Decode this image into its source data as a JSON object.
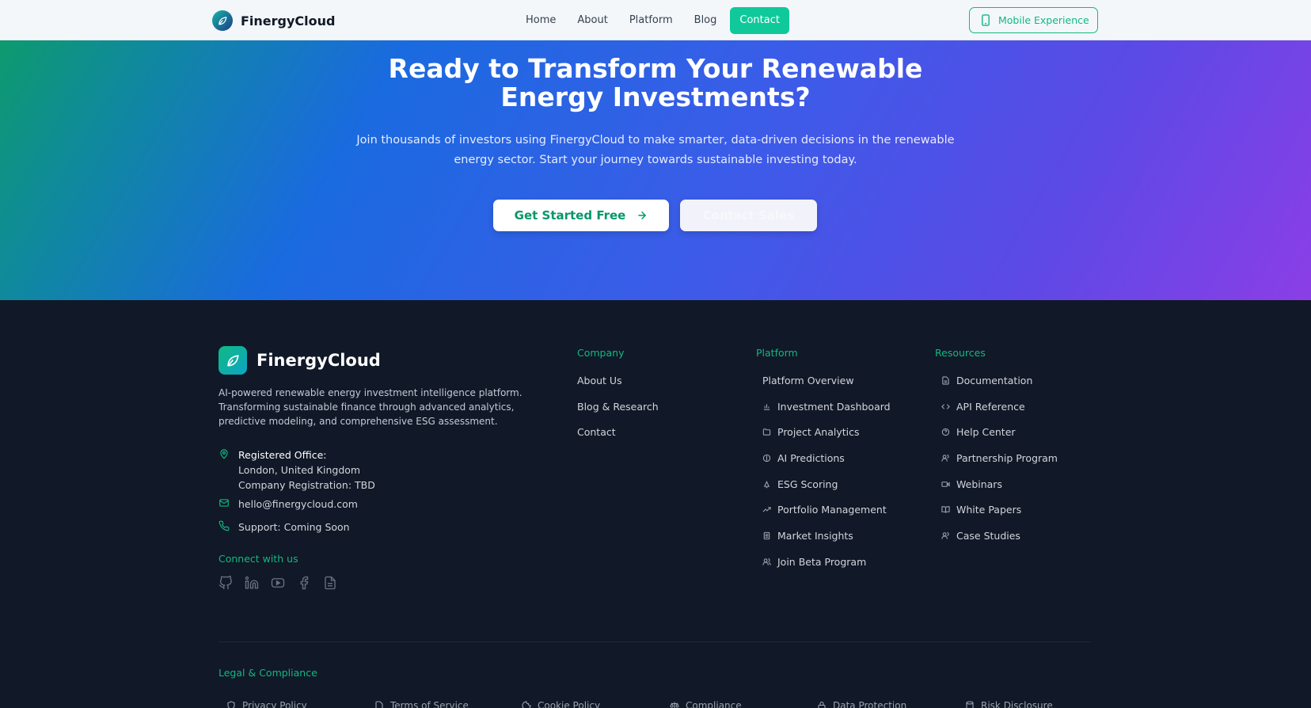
{
  "nav": {
    "brand": "FinergyCloud",
    "links": [
      {
        "label": "Home"
      },
      {
        "label": "About"
      },
      {
        "label": "Platform"
      },
      {
        "label": "Blog"
      },
      {
        "label": "Contact"
      }
    ],
    "mobile_button": "Mobile Experience"
  },
  "hero": {
    "title": "Ready to Transform Your Renewable Energy Investments?",
    "subtitle": "Join thousands of investors using FinergyCloud to make smarter, data-driven decisions in the renewable energy sector. Start your journey towards sustainable investing today.",
    "primary_button": "Get Started Free",
    "secondary_button": "Contact Sales"
  },
  "footer": {
    "brand": "FinergyCloud",
    "description": "AI-powered renewable energy investment intelligence platform. Transforming sustainable finance through advanced analytics, predictive modeling, and comprehensive ESG assessment.",
    "office": {
      "label": "Registered Office:",
      "line1": "London, United Kingdom",
      "line2": "Company Registration: TBD"
    },
    "email": "hello@finergycloud.com",
    "support": "Support: Coming Soon",
    "connect_title": "Connect with us",
    "socials": [
      "github-icon",
      "linkedin-icon",
      "youtube-icon",
      "facebook-icon",
      "document-icon"
    ],
    "company": {
      "title": "Company",
      "items": [
        {
          "label": "About Us"
        },
        {
          "label": "Blog & Research"
        },
        {
          "label": "Contact"
        }
      ]
    },
    "platform": {
      "title": "Platform",
      "items": [
        {
          "label": "Platform Overview",
          "icon": ""
        },
        {
          "label": "Investment Dashboard",
          "icon": "bar-chart-icon"
        },
        {
          "label": "Project Analytics",
          "icon": "folder-icon"
        },
        {
          "label": "AI Predictions",
          "icon": "brain-icon"
        },
        {
          "label": "ESG Scoring",
          "icon": "leaf-icon"
        },
        {
          "label": "Portfolio Management",
          "icon": "trending-up-icon"
        },
        {
          "label": "Market Insights",
          "icon": "newspaper-icon"
        },
        {
          "label": "Join Beta Program",
          "icon": "users-icon"
        }
      ]
    },
    "resources": {
      "title": "Resources",
      "items": [
        {
          "label": "Documentation",
          "icon": "file-icon"
        },
        {
          "label": "API Reference",
          "icon": "code-icon"
        },
        {
          "label": "Help Center",
          "icon": "help-icon"
        },
        {
          "label": "Partnership Program",
          "icon": "users-icon"
        },
        {
          "label": "Webinars",
          "icon": "video-icon"
        },
        {
          "label": "White Papers",
          "icon": "book-icon"
        },
        {
          "label": "Case Studies",
          "icon": "users-icon"
        }
      ]
    },
    "legal": {
      "title": "Legal & Compliance",
      "items": [
        {
          "label": "Privacy Policy",
          "icon": "shield-icon"
        },
        {
          "label": "Terms of Service",
          "icon": "file-icon"
        },
        {
          "label": "Cookie Policy",
          "icon": "cookie-icon"
        },
        {
          "label": "Compliance",
          "icon": "scale-icon"
        },
        {
          "label": "Data Protection",
          "icon": "lock-icon"
        },
        {
          "label": "Risk Disclosure",
          "icon": "database-icon"
        }
      ]
    }
  },
  "colors": {
    "accent": "#10b981",
    "footer_bg": "#111827",
    "hero_start": "#0e9a6e",
    "hero_mid": "#3b5ce8",
    "hero_end": "#8b3ee6"
  }
}
